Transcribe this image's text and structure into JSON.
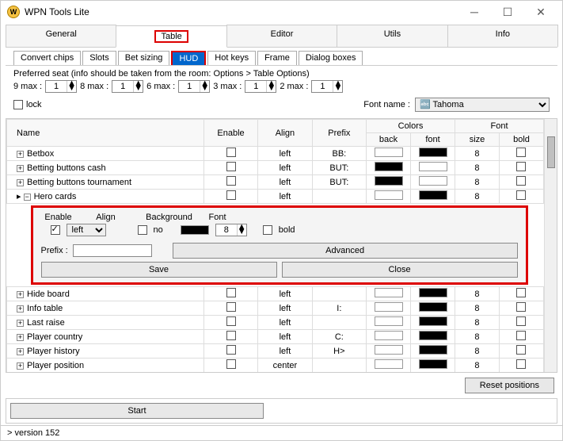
{
  "window": {
    "title": "WPN Tools Lite"
  },
  "mainTabs": [
    "General",
    "Table",
    "Editor",
    "Utils",
    "Info"
  ],
  "subTabs": [
    "Convert chips",
    "Slots",
    "Bet sizing",
    "HUD",
    "Hot keys",
    "Frame",
    "Dialog boxes"
  ],
  "prefSeat": {
    "label": "Preferred seat (info should be taken from the room: Options > Table Options)",
    "items": [
      {
        "label": "9 max :",
        "val": "1"
      },
      {
        "label": "8 max :",
        "val": "1"
      },
      {
        "label": "6 max :",
        "val": "1"
      },
      {
        "label": "3 max :",
        "val": "1"
      },
      {
        "label": "2 max :",
        "val": "1"
      }
    ]
  },
  "lockLabel": "lock",
  "fontNameLabel": "Font name :",
  "fontNameValue": "Tahoma",
  "headers": {
    "name": "Name",
    "enable": "Enable",
    "align": "Align",
    "prefix": "Prefix",
    "colors": "Colors",
    "font": "Font",
    "back": "back",
    "fontc": "font",
    "size": "size",
    "bold": "bold"
  },
  "rows": [
    {
      "name": "Betbox",
      "align": "left",
      "prefix": "BB:",
      "back": "white",
      "font": "black",
      "size": "8"
    },
    {
      "name": "Betting buttons cash",
      "align": "left",
      "prefix": "BUT:",
      "back": "black",
      "font": "white",
      "size": "8"
    },
    {
      "name": "Betting buttons tournament",
      "align": "left",
      "prefix": "BUT:",
      "back": "black",
      "font": "white",
      "size": "8"
    },
    {
      "name": "Hero cards",
      "align": "left",
      "prefix": "",
      "back": "white",
      "font": "black",
      "size": "8",
      "expanded": true
    }
  ],
  "rows2": [
    {
      "name": "Hide board",
      "align": "left",
      "prefix": "",
      "back": "white",
      "font": "black",
      "size": "8"
    },
    {
      "name": "Info table",
      "align": "left",
      "prefix": "I:",
      "back": "white",
      "font": "black",
      "size": "8"
    },
    {
      "name": "Last raise",
      "align": "left",
      "prefix": "",
      "back": "white",
      "font": "black",
      "size": "8"
    },
    {
      "name": "Player country",
      "align": "left",
      "prefix": "C:",
      "back": "white",
      "font": "black",
      "size": "8"
    },
    {
      "name": "Player history",
      "align": "left",
      "prefix": "H>",
      "back": "white",
      "font": "black",
      "size": "8"
    },
    {
      "name": "Player position",
      "align": "center",
      "prefix": "",
      "back": "white",
      "font": "black",
      "size": "8"
    }
  ],
  "edit": {
    "labels": {
      "enable": "Enable",
      "align": "Align",
      "background": "Background",
      "font": "Font"
    },
    "alignVal": "left",
    "noLabel": "no",
    "sizeVal": "8",
    "boldLabel": "bold",
    "prefixLabel": "Prefix :",
    "prefixVal": "",
    "advanced": "Advanced",
    "save": "Save",
    "close": "Close"
  },
  "resetBtn": "Reset positions",
  "startBtn": "Start",
  "status": "version 152"
}
